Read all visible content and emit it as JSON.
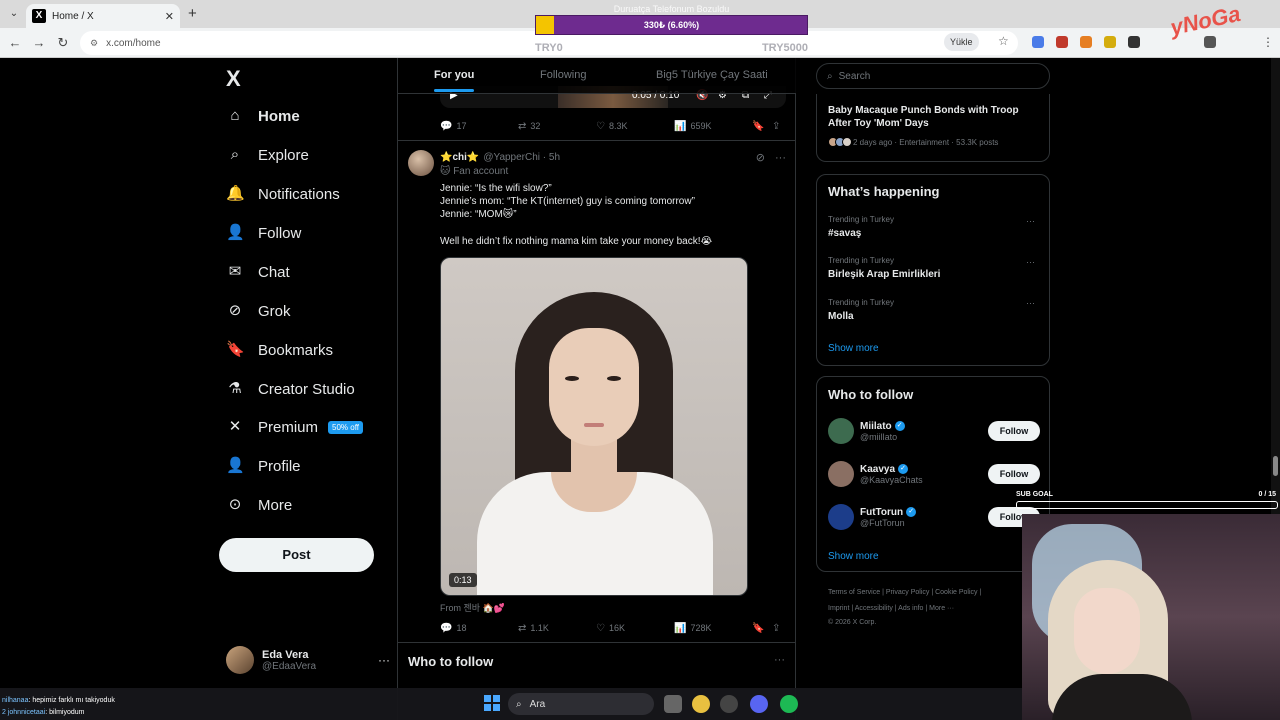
{
  "browser": {
    "tab_title": "Home / X",
    "tab_favicon": "X",
    "url": "x.com/home",
    "save_button": "Yükle",
    "menu_glyph": "⌄",
    "close_glyph": "✕",
    "newtab_glyph": "+"
  },
  "overlay": {
    "donation_caption": "Duruatça Telefonum Bozuldu",
    "donation_percent_text": "330₺ (6.60%)",
    "donation_fraction": 0.066,
    "donation_min": "TRY0",
    "donation_max": "TRY5000",
    "brand_logo": "yNoGa",
    "sub_goal_label": "SUB GOAL",
    "sub_goal_count": "0 / 15",
    "sub_goal_fraction": 0
  },
  "sidebar": {
    "logo": "X",
    "items": [
      {
        "label": "Home",
        "icon": "home-icon",
        "glyph": "⌂"
      },
      {
        "label": "Explore",
        "icon": "search-icon",
        "glyph": "⌕"
      },
      {
        "label": "Notifications",
        "icon": "bell-icon",
        "glyph": "🔔"
      },
      {
        "label": "Follow",
        "icon": "add-user-icon",
        "glyph": "👤"
      },
      {
        "label": "Chat",
        "icon": "mail-icon",
        "glyph": "✉"
      },
      {
        "label": "Grok",
        "icon": "grok-icon",
        "glyph": "⊘"
      },
      {
        "label": "Bookmarks",
        "icon": "bookmark-icon",
        "glyph": "🔖"
      },
      {
        "label": "Creator Studio",
        "icon": "flask-icon",
        "glyph": "⚗"
      },
      {
        "label": "Premium",
        "icon": "x-icon",
        "glyph": "✕"
      },
      {
        "label": "Profile",
        "icon": "profile-icon",
        "glyph": "👤"
      },
      {
        "label": "More",
        "icon": "more-circle-icon",
        "glyph": "⊙"
      }
    ],
    "premium_badge": "50% off",
    "post_button": "Post",
    "account_name": "Eda Vera",
    "account_handle": "@EdaaVera",
    "account_more": "···"
  },
  "feed": {
    "tabs": [
      "For you",
      "Following",
      "Big5 Türkiye Çay Saati"
    ],
    "prev_video_time": "0:05 / 0:10",
    "prev_actions": {
      "replies": "17",
      "reposts": "32",
      "likes": "8.3K",
      "views": "659K"
    },
    "tweet": {
      "name": "⭐chi⭐",
      "handle": "@YapperChi · 5h",
      "fan_label": "🐱 Fan account",
      "lines": [
        "Jennie: “Is the wifi slow?”",
        "Jennie’s mom: “The KT(internet) guy is coming tomorrow”",
        "Jennie: “MOM😿”",
        "Well he didn’t fix nothing mama kim take your money back!😭"
      ],
      "video_duration": "0:13",
      "from_label": "From 젠바 🏠💕",
      "actions": {
        "replies": "18",
        "reposts": "1.1K",
        "likes": "16K",
        "views": "728K"
      }
    },
    "who_to_follow_title": "Who to follow",
    "who_to_follow_more": "···"
  },
  "right": {
    "search_placeholder": "Search",
    "news": {
      "title": "Baby Macaque Punch Bonds with Troop After Toy 'Mom' Days",
      "meta": "2 days ago · Entertainment · 53.3K posts"
    },
    "whats_happening": "What’s happening",
    "trends": [
      {
        "context": "Trending in Turkey",
        "name": "#savaş"
      },
      {
        "context": "Trending in Turkey",
        "name": "Birleşik Arap Emirlikleri"
      },
      {
        "context": "Trending in Turkey",
        "name": "Molla"
      }
    ],
    "show_more": "Show more",
    "who_to_follow": "Who to follow",
    "follow_suggestions": [
      {
        "name": "Miilato",
        "handle": "@miillato",
        "button": "Follow",
        "color": "#3d6b4f"
      },
      {
        "name": "Kaavya",
        "handle": "@KaavyaChats",
        "button": "Follow",
        "color": "#8a6f63"
      },
      {
        "name": "FutTorun",
        "handle": "@FutTorun",
        "button": "Follow",
        "color": "#1c3d8a"
      }
    ],
    "footer_line1": "Terms of Service  |  Privacy Policy  |  Cookie Policy  |",
    "footer_line2": "Imprint  |  Accessibility  |  Ads info  |  More ···",
    "footer_line3": "© 2026 X Corp."
  },
  "taskbar": {
    "search_placeholder": "Ara",
    "chat_line1_user": "nilhanaa",
    "chat_line1_msg": ": hepimiz farklı mı takiyoduk",
    "chat_line2_user": "2 johnnicetaai",
    "chat_line2_msg": ": bilmiyodum"
  },
  "colors": {
    "accent": "#1d9bf0",
    "background": "#000000",
    "border": "#2f3336",
    "donation_fill": "#f4c400",
    "donation_bar": "#6e2b8f"
  }
}
